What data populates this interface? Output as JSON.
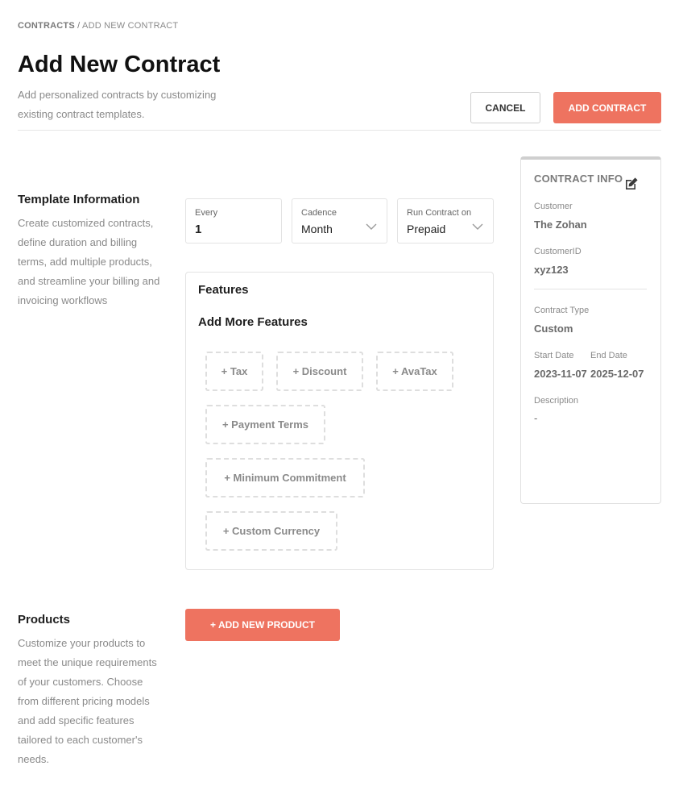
{
  "breadcrumb": {
    "root": "CONTRACTS",
    "separator": "/",
    "current": "ADD NEW CONTRACT"
  },
  "page": {
    "title": "Add New Contract",
    "subtitle": "Add personalized contracts by customizing existing contract templates."
  },
  "actions": {
    "cancel_label": "CANCEL",
    "add_contract_label": "ADD CONTRACT"
  },
  "template_info": {
    "title": "Template Information",
    "description": "Create customized contracts, define duration and billing terms, add multiple products, and streamline your billing and invoicing workflows"
  },
  "fields": {
    "every": {
      "label": "Every",
      "value": "1"
    },
    "cadence": {
      "label": "Cadence",
      "value": "Month"
    },
    "run_contract_on": {
      "label": "Run Contract on",
      "value": "Prepaid"
    }
  },
  "features": {
    "title": "Features",
    "subtitle": "Add More Features",
    "chips": [
      "+ Tax",
      "+ Discount",
      "+ AvaTax",
      "+ Payment Terms",
      "+ Minimum Commitment",
      "+ Custom Currency"
    ]
  },
  "contract_info": {
    "title": "CONTRACT INFO",
    "customer_label": "Customer",
    "customer_value": "The Zohan",
    "customer_id_label": "CustomerID",
    "customer_id_value": "xyz123",
    "contract_type_label": "Contract Type",
    "contract_type_value": "Custom",
    "start_date_label": "Start Date",
    "start_date_value": "2023-11-07",
    "end_date_label": "End Date",
    "end_date_value": "2025-12-07",
    "description_label": "Description",
    "description_value": "-"
  },
  "products": {
    "title": "Products",
    "description": "Customize your products to meet the unique requirements of your customers. Choose from different pricing models and add specific features tailored to each customer's needs.",
    "add_label": "+ ADD NEW PRODUCT"
  },
  "colors": {
    "accent": "#ee7360",
    "muted_text": "#8a8a8a",
    "border": "#e3e3e3"
  },
  "icons": {
    "edit": "edit-icon",
    "dropdown": "chevron-down-icon"
  }
}
